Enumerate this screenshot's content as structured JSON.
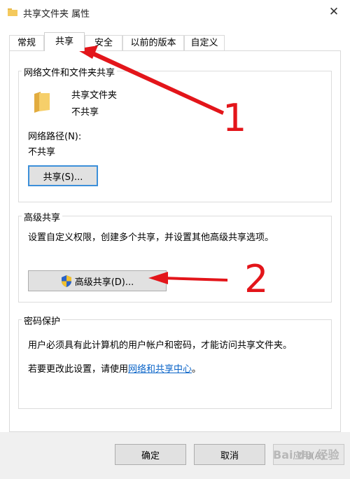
{
  "window": {
    "title": "共享文件夹 属性",
    "close_glyph": "✕"
  },
  "tabs": [
    {
      "label": "常规",
      "active": false
    },
    {
      "label": "共享",
      "active": true
    },
    {
      "label": "安全",
      "active": false
    },
    {
      "label": "以前的版本",
      "active": false
    },
    {
      "label": "自定义",
      "active": false
    }
  ],
  "network_sharing": {
    "group_title": "网络文件和文件夹共享",
    "folder_name": "共享文件夹",
    "folder_status": "不共享",
    "path_label": "网络路径(N):",
    "path_value": "不共享",
    "share_button": "共享(S)..."
  },
  "advanced_sharing": {
    "group_title": "高级共享",
    "description": "设置自定义权限，创建多个共享，并设置其他高级共享选项。",
    "button": "高级共享(D)..."
  },
  "password_protection": {
    "group_title": "密码保护",
    "description": "用户必须具有此计算机的用户帐户和密码，才能访问共享文件夹。",
    "change_prefix": "若要更改此设置，请使用",
    "change_link": "网络和共享中心",
    "change_suffix": "。"
  },
  "footer": {
    "ok_button": "确定",
    "cancel_button": "取消",
    "apply_button": "应用(A)"
  },
  "annotations": {
    "marker_1": "1",
    "marker_2": "2",
    "color": "#e3151a"
  },
  "watermark": "Bai du 经验",
  "icons": [
    "folder-icon",
    "shield-uac-icon",
    "close-icon"
  ]
}
